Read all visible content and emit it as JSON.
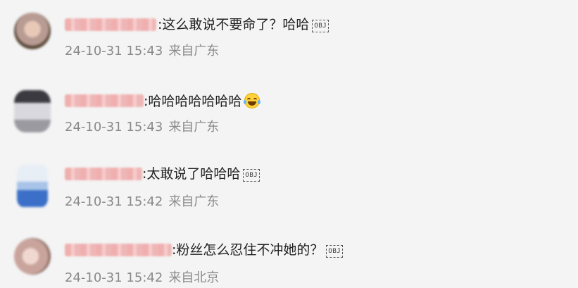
{
  "comments": [
    {
      "text": ":这么敢说不要命了？哈哈",
      "inline_icon": "obj-placeholder-icon",
      "obj_label": "OBJ",
      "time": "24-10-31 15:43",
      "location": "来自广东",
      "avatar_colors": [
        "#b89b93",
        "#e8c9b8",
        "#5a4a3a"
      ]
    },
    {
      "text": ":哈哈哈哈哈哈哈",
      "inline_icon": "laughing-tears-emoji-icon",
      "time": "24-10-31 15:43",
      "location": "来自广东",
      "avatar_colors": [
        "#9a9aa0",
        "#d8d8de",
        "#3a3a40"
      ]
    },
    {
      "text": ":太敢说了哈哈哈",
      "inline_icon": "obj-placeholder-icon",
      "obj_label": "OBJ",
      "time": "24-10-31 15:42",
      "location": "来自广东",
      "avatar_colors": [
        "#a8c4e8",
        "#e8eef6",
        "#3b6fc8"
      ]
    },
    {
      "text": ":粉丝怎么忍住不冲她的？",
      "inline_icon": "obj-placeholder-icon",
      "obj_label": "OBJ",
      "time": "24-10-31 15:42",
      "location": "来自北京",
      "avatar_colors": [
        "#c8a49c",
        "#f0d8d0",
        "#8a6a62"
      ]
    }
  ]
}
